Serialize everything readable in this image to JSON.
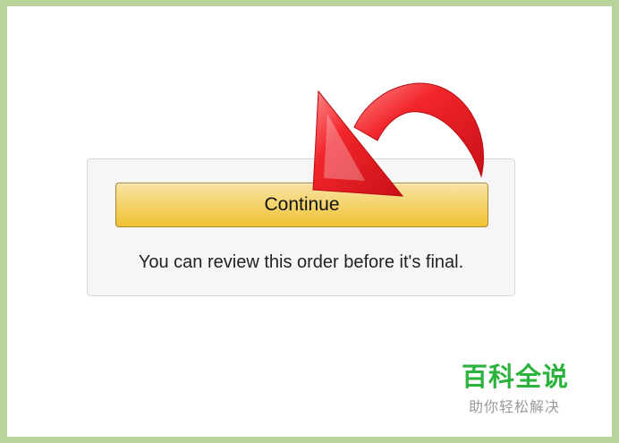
{
  "checkout": {
    "continue_label": "Continue",
    "review_note": "You can review this order before it's final."
  },
  "watermark": {
    "title": "百科全说",
    "subtitle": "助你轻松解决"
  },
  "colors": {
    "frame_border": "#b9d49b",
    "button_top": "#f8e3a5",
    "button_bottom": "#efc233",
    "arrow": "#e3171d",
    "watermark_green": "#2bb33d"
  },
  "annotation": {
    "icon": "pointing-arrow-icon"
  }
}
